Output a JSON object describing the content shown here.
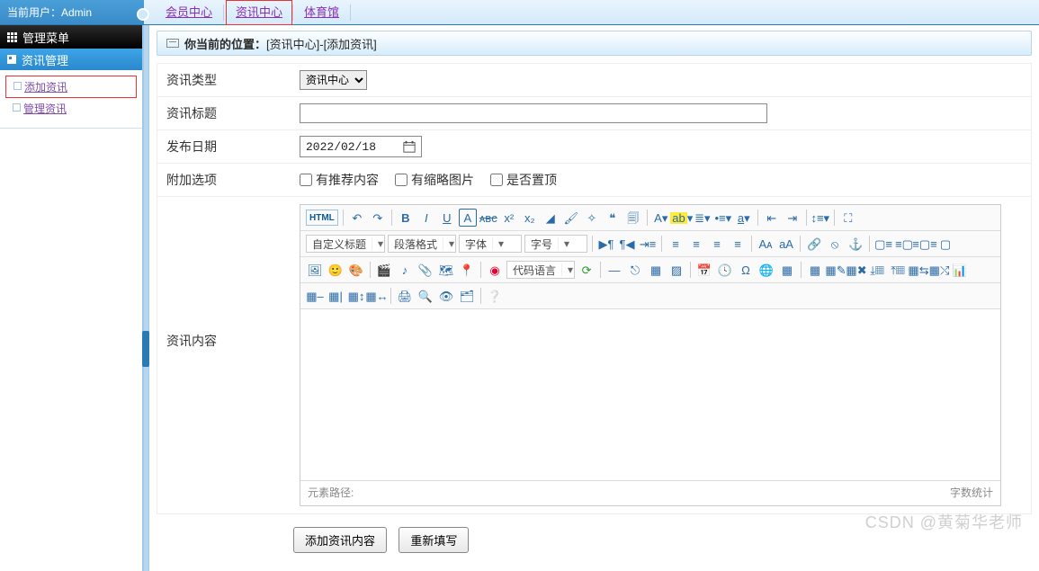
{
  "topbar": {
    "current_user_label": "当前用户：Admin",
    "nav": [
      {
        "label": "会员中心",
        "highlight": false
      },
      {
        "label": "资讯中心",
        "highlight": true
      },
      {
        "label": "体育馆",
        "highlight": false
      }
    ]
  },
  "sidebar": {
    "header": "管理菜单",
    "group": "资讯管理",
    "items": [
      {
        "label": "添加资讯",
        "highlight": true
      },
      {
        "label": "管理资讯",
        "highlight": false
      }
    ]
  },
  "breadcrumb": {
    "prefix": "你当前的位置：",
    "text": "[资讯中心]-[添加资讯]"
  },
  "form": {
    "type": {
      "label": "资讯类型",
      "selected": "资讯中心",
      "options": [
        "资讯中心"
      ]
    },
    "title": {
      "label": "资讯标题",
      "value": ""
    },
    "date": {
      "label": "发布日期",
      "value": "2022/02/18"
    },
    "extra": {
      "label": "附加选项",
      "options": [
        {
          "label": "有推荐内容",
          "checked": false
        },
        {
          "label": "有缩略图片",
          "checked": false
        },
        {
          "label": "是否置顶",
          "checked": false
        }
      ]
    },
    "content": {
      "label": "资讯内容"
    }
  },
  "editor": {
    "html_button": "HTML",
    "combos": {
      "custom_title": "自定义标题",
      "para_format": "段落格式",
      "font_family": "字体",
      "font_size": "字号",
      "code_lang": "代码语言"
    },
    "path_label": "元素路径:",
    "wordcount_label": "字数统计"
  },
  "actions": {
    "submit": "添加资讯内容",
    "reset": "重新填写"
  },
  "watermark": "CSDN @黄菊华老师"
}
